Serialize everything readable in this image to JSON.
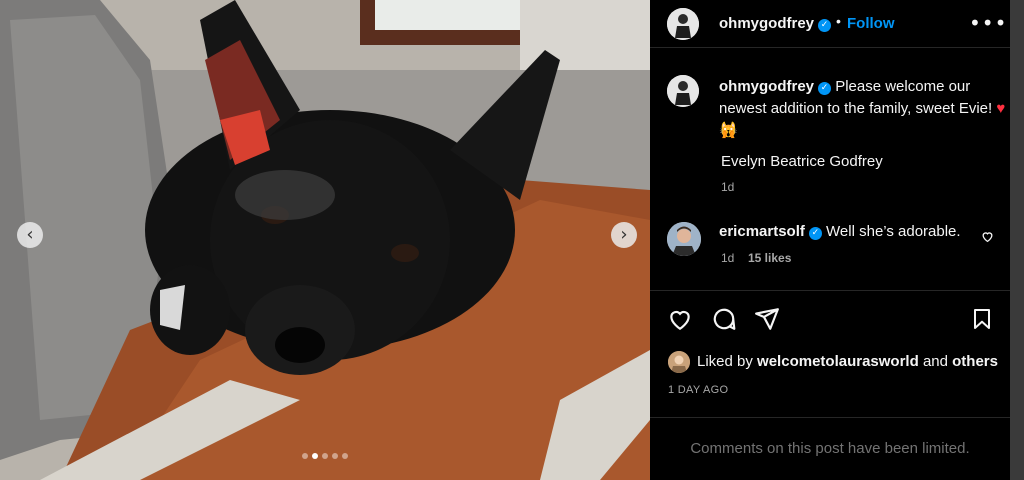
{
  "post": {
    "media": {
      "description_icon": "puppy-photo",
      "carousel_count": 5,
      "carousel_active": 2
    },
    "header": {
      "username": "ohmygodfrey",
      "separator": "•",
      "follow_label": "Follow",
      "more_icon": "•••"
    },
    "caption": {
      "username": "ohmygodfrey",
      "text": "Please welcome our newest addition to the family, sweet Evie!",
      "emoji_heart": "♥",
      "emoji_face": "🙀",
      "full_name": "Evelyn Beatrice Godfrey",
      "time": "1d"
    },
    "comments": [
      {
        "username": "ericmartsolf",
        "text": "Well she’s adorable.",
        "time": "1d",
        "likes": "15 likes"
      }
    ],
    "liked_by": {
      "prefix": "Liked by",
      "user": "welcometolaurasworld",
      "conj": "and",
      "others": "others"
    },
    "time_ago": "1 DAY AGO",
    "comments_limited": "Comments on this post have been limited.",
    "colors": {
      "accent": "#0095f6",
      "background": "#000000",
      "secondary_text": "#a8a8a8"
    }
  }
}
